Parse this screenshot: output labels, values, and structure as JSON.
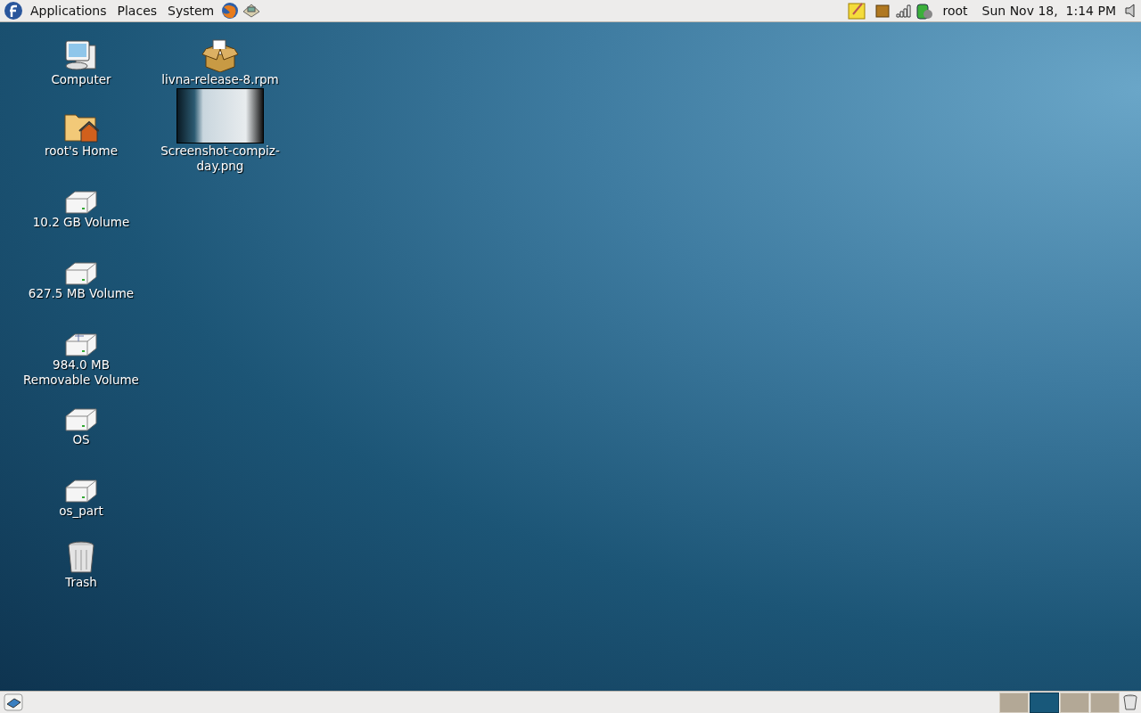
{
  "top_panel": {
    "menus": [
      "Applications",
      "Places",
      "System"
    ],
    "user": "root",
    "clock": "Sun Nov 18,  1:14 PM"
  },
  "desktop": {
    "columns": [
      [
        {
          "label": "Computer",
          "kind": "computer"
        },
        {
          "label": "root's Home",
          "kind": "home"
        },
        {
          "label": "10.2 GB Volume",
          "kind": "drive"
        },
        {
          "label": "627.5 MB Volume",
          "kind": "drive"
        },
        {
          "label": "984.0 MB Removable Volume",
          "kind": "removable"
        },
        {
          "label": "OS",
          "kind": "drive"
        },
        {
          "label": "os_part",
          "kind": "drive"
        },
        {
          "label": "Trash",
          "kind": "trash"
        }
      ],
      [
        {
          "label": "livna-release-8.rpm",
          "kind": "package"
        },
        {
          "label": "Screenshot-compiz-day.png",
          "kind": "image"
        }
      ]
    ]
  },
  "bottom_panel": {
    "workspaces": [
      {
        "selected": false
      },
      {
        "selected": true
      },
      {
        "selected": false
      },
      {
        "selected": false
      }
    ]
  }
}
